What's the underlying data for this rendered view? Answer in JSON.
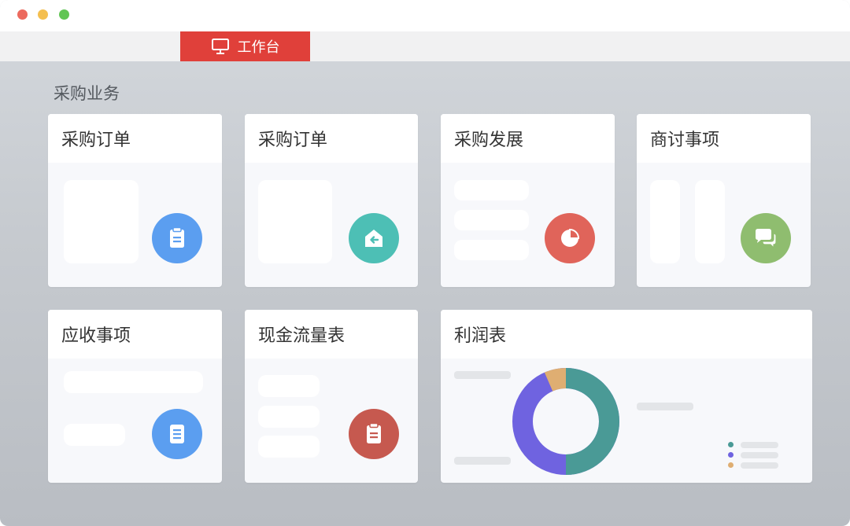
{
  "tabs": {
    "active_label": "工作台"
  },
  "section": {
    "title": "采购业务"
  },
  "cards": [
    {
      "title": "采购订单",
      "icon": "clipboard-icon",
      "color": "#5b9ef0"
    },
    {
      "title": "采购订单",
      "icon": "return-box-icon",
      "color": "#4dbfb5"
    },
    {
      "title": "采购发展",
      "icon": "pie-chart-icon",
      "color": "#e0645a"
    },
    {
      "title": "商讨事项",
      "icon": "chat-bubbles-icon",
      "color": "#8fbd6f"
    },
    {
      "title": "应收事项",
      "icon": "document-icon",
      "color": "#5b9ef0"
    },
    {
      "title": "现金流量表",
      "icon": "clipboard-icon",
      "color": "#c6594f"
    },
    {
      "title": "利润表",
      "icon": "donut-chart-icon",
      "color": "#4a9a96"
    }
  ],
  "colors": {
    "accent": "#e0403a",
    "donut_teal": "#4a9a96",
    "donut_purple": "#6f63e0",
    "donut_tan": "#dfae72"
  }
}
